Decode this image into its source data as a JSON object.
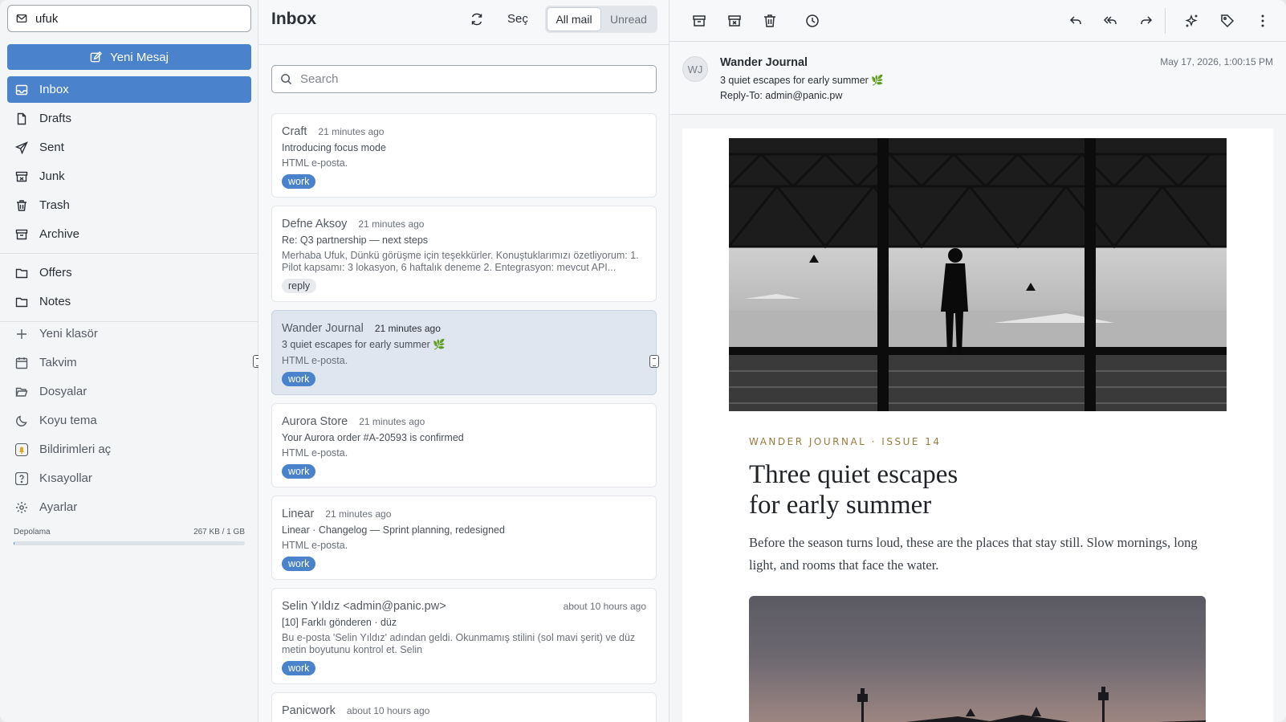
{
  "account": {
    "name": "ufuk"
  },
  "compose": {
    "label": "Yeni Mesaj"
  },
  "nav": {
    "mailboxes": [
      {
        "label": "Inbox",
        "icon": "inbox-icon"
      },
      {
        "label": "Drafts",
        "icon": "file-icon"
      },
      {
        "label": "Sent",
        "icon": "send-icon"
      },
      {
        "label": "Junk",
        "icon": "junk-icon"
      },
      {
        "label": "Trash",
        "icon": "trash-icon"
      },
      {
        "label": "Archive",
        "icon": "archive-icon"
      }
    ],
    "folders": [
      {
        "label": "Offers",
        "icon": "folder-icon"
      },
      {
        "label": "Notes",
        "icon": "folder-icon"
      }
    ],
    "utilities": [
      {
        "label": "Yeni klasör",
        "icon": "plus-icon"
      },
      {
        "label": "Takvim",
        "icon": "calendar-icon"
      },
      {
        "label": "Dosyalar",
        "icon": "folder-open-icon"
      },
      {
        "label": "Koyu tema",
        "icon": "moon-icon"
      },
      {
        "label": "Bildirimleri aç",
        "icon": "bell-icon"
      },
      {
        "label": "Kısayollar",
        "icon": "help-icon"
      },
      {
        "label": "Ayarlar",
        "icon": "gear-icon"
      }
    ]
  },
  "storage": {
    "label": "Depolama",
    "value": "267 KB / 1 GB",
    "fraction": 0.0003
  },
  "list": {
    "title": "Inbox",
    "select_label": "Seç",
    "filters": [
      "All mail",
      "Unread"
    ],
    "active_filter": "All mail",
    "search_placeholder": "Search",
    "messages": [
      {
        "from": "Craft",
        "time": "21 minutes ago",
        "subject": "Introducing focus mode",
        "preview": "HTML e-posta.",
        "tag": "work"
      },
      {
        "from": "Defne Aksoy",
        "time": "21 minutes ago",
        "subject": "Re: Q3 partnership — next steps",
        "preview": "Merhaba Ufuk, Dünkü görüşme için teşekkürler. Konuştuklarımızı özetliyorum: 1. Pilot kapsamı: 3 lokasyon, 6 haftalık deneme 2. Entegrasyon: mevcut API...",
        "tag": "reply"
      },
      {
        "from": "Wander Journal",
        "time": "21 minutes ago",
        "subject": "3 quiet escapes for early summer 🌿",
        "preview": "HTML e-posta.",
        "tag": "work",
        "selected": true
      },
      {
        "from": "Aurora Store",
        "time": "21 minutes ago",
        "subject": "Your Aurora order #A-20593 is confirmed",
        "preview": "HTML e-posta.",
        "tag": "work"
      },
      {
        "from": "Linear",
        "time": "21 minutes ago",
        "subject": "Linear · Changelog — Sprint planning, redesigned",
        "preview": "HTML e-posta.",
        "tag": "work"
      },
      {
        "from": "Selin Yıldız <admin@panic.pw>",
        "time": "about 10 hours ago",
        "subject": "[10] Farklı gönderen · düz",
        "preview": "Bu e-posta 'Selin Yıldız' adından geldi. Okunmamış stilini (sol mavi şerit) ve düz metin boyutunu kontrol et. Selin",
        "tag": "work"
      },
      {
        "from": "Panicwork",
        "time": "about 10 hours ago",
        "subject": "",
        "preview": "",
        "tag": ""
      }
    ]
  },
  "reader": {
    "avatar_initials": "WJ",
    "sender": "Wander Journal",
    "subject": "3 quiet escapes for early summer 🌿",
    "reply_to_label": "Reply-To:",
    "reply_to": "admin@panic.pw",
    "date": "May 17, 2026, 1:00:15 PM",
    "email": {
      "kicker": "WANDER JOURNAL · ISSUE 14",
      "headline_line1": "Three quiet escapes",
      "headline_line2": "for early summer",
      "lede": "Before the season turns loud, these are the places that stay still. Slow mornings, long light, and rooms that face the water."
    }
  },
  "colors": {
    "accent": "#4a82cc",
    "kicker": "#9a7a3f",
    "selected_row": "#dfe6f0"
  }
}
